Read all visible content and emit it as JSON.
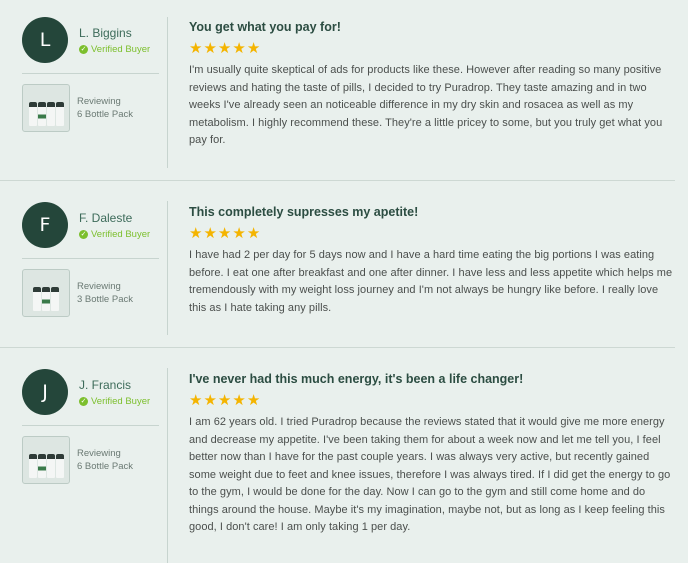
{
  "reviews": [
    {
      "initial": "L",
      "name": "L. Biggins",
      "verified": "Verified Buyer",
      "reviewing_label": "Reviewing",
      "product": "6 Bottle Pack",
      "title": "You get what you pay for!",
      "rating": 5,
      "text": "I'm usually quite skeptical of ads for products like these. However after reading so many positive reviews and hating the taste of pills, I decided to try Puradrop. They taste amazing and in two weeks I've already seen an noticeable difference in my dry skin and rosacea as well as my metabolism. I highly recommend these. They're a little pricey to some, but you truly get what you pay for."
    },
    {
      "initial": "F",
      "name": "F. Daleste",
      "verified": "Verified Buyer",
      "reviewing_label": "Reviewing",
      "product": "3 Bottle Pack",
      "title": "This completely supresses my apetite!",
      "rating": 5,
      "text": "I have had 2 per day for 5 days now and I have a hard time eating the big portions I was eating before. I eat one after breakfast and one after dinner. I have less and less appetite which helps me tremendously with my weight loss journey and I'm not always be hungry like before. I really love this as I hate taking any pills."
    },
    {
      "initial": "J",
      "name": "J. Francis",
      "verified": "Verified Buyer",
      "reviewing_label": "Reviewing",
      "product": "6 Bottle Pack",
      "title": "I've never had this much energy, it's been a life changer!",
      "rating": 5,
      "text": "I am 62 years old. I tried Puradrop because the reviews stated that it would give me more energy and decrease my appetite. I've been taking them for about a week now and let me tell you, I feel better now than I have for the past couple years. I was always very active, but recently gained some weight due to feet and knee issues, therefore I was always tired. If I did get the energy to go to the gym, I would be done for the day. Now I can go to the gym and still come home and do things around the house. Maybe it's my imagination, maybe not, but as long as I keep feeling this good, I don't care! I am only taking 1 per day."
    }
  ],
  "colors": {
    "avatar_bg": "#24463a",
    "verified": "#7cbf2d",
    "star": "#f4b400",
    "title": "#2c4d42"
  }
}
